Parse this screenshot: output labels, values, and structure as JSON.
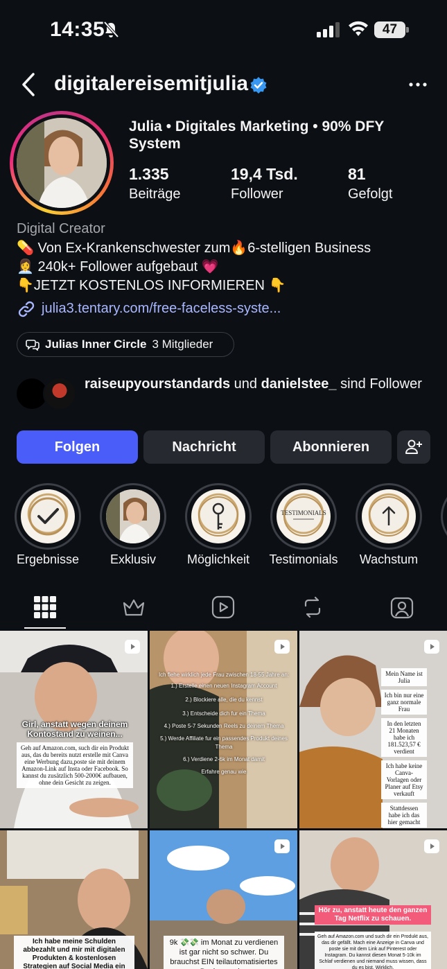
{
  "status_bar": {
    "time": "14:35",
    "battery": "47"
  },
  "header": {
    "username": "digitalereisemitjulia"
  },
  "profile": {
    "full_name": "Julia • Digitales Marketing • 90% DFY System",
    "stats": [
      {
        "value": "1.335",
        "label": "Beiträge"
      },
      {
        "value": "19,4 Tsd.",
        "label": "Follower"
      },
      {
        "value": "81",
        "label": "Gefolgt"
      }
    ],
    "category": "Digital Creator",
    "bio": [
      "💊 Von Ex-Krankenschwester zum🔥6-stelligen Business",
      "👩‍💼 240k+ Follower aufgebaut 💗",
      "👇JETZT KOSTENLOS INFORMIEREN 👇"
    ],
    "link": "julia3.tentary.com/free-faceless-syste...",
    "channel": {
      "name": "Julias Inner Circle",
      "members": "3 Mitglieder"
    },
    "followed_by": {
      "user1": "raiseupyourstandards",
      "middle": " und ",
      "user2": "danielstee_",
      "suffix": " sind Follower"
    }
  },
  "buttons": {
    "follow": "Folgen",
    "message": "Nachricht",
    "subscribe": "Abonnieren"
  },
  "highlights": [
    {
      "label": "Ergebnisse",
      "icon": "check-icon"
    },
    {
      "label": "Exklusiv",
      "icon": "photo"
    },
    {
      "label": "Möglichkeit",
      "icon": "key-icon"
    },
    {
      "label": "Testimonials",
      "icon": "testimonials-badge",
      "badge_text": "TESTIMONIALS"
    },
    {
      "label": "Wachstum",
      "icon": "arrow-up-icon"
    }
  ],
  "tabs": [
    "grid-icon",
    "crown-icon",
    "reels-icon",
    "repost-icon",
    "tagged-icon"
  ],
  "posts": [
    {
      "title": "Girl, anstatt wegen deinem Kontostand zu weinen...",
      "body": "Geh auf Amazon.com, such dir ein Produkt aus, das du bereits nutzt erstelle mit Canva eine Werbung dazu,poste sie mit deinem Amazon-Link auf Insta oder Facebook. So kannst du zusätzlich 500-2000€ aufbauen, ohne dein Gesicht zu zeigen."
    },
    {
      "lines": [
        "Ich flehe wirklich jede Frau zwischen 18-55 Jahre an:",
        "1.) Erstelle einen neuen Instagram Account",
        "2.) Blockiere alle, die du kennst",
        "3.) Entscheide dich fur ein Thema",
        "4.) Poste 5-7 Sekunden Reels zu deinem Thema",
        "5.) Werde Affiliate fur ein passendes Produkt deines Thema",
        "6.) Verdiene 2-6k im Monat damit",
        "Erfahre genau wie"
      ]
    },
    {
      "boxes": [
        "Mein Name ist Julia",
        "Ich bin nur eine ganz normale Frau",
        "In den letzten 21 Monaten habe ich 181.523,57 € verdient",
        "Ich habe keine Canva-Vorlagen oder Planer auf Etsy verkauft",
        "Stattdessen habe ich das hier gemacht"
      ]
    },
    {
      "text": "Ich habe meine Schulden abbezahlt und mir mit digitalen Produkten & kostenlosen Strategien auf Social Media ein erfolgreiches Online-"
    },
    {
      "text": "9k 💸💸 im Monat zu verdienen ist gar nicht so schwer. Du brauchst EIN teilautomatisiertes Business, das"
    },
    {
      "title": "Hör zu, anstatt heute den ganzen Tag Netflix zu schauen.",
      "body": "Geh auf Amazon.com und such dir ein Produkt aus, das dir gefällt. Mach eine Anzeige in Canva und poste sie mit dem Link auf Pinterest oder Instagram. Du kannst diesen Monat 5-10k im Schlaf verdienen und niemand muss wissen, dass du es bist. Wirklich."
    }
  ]
}
